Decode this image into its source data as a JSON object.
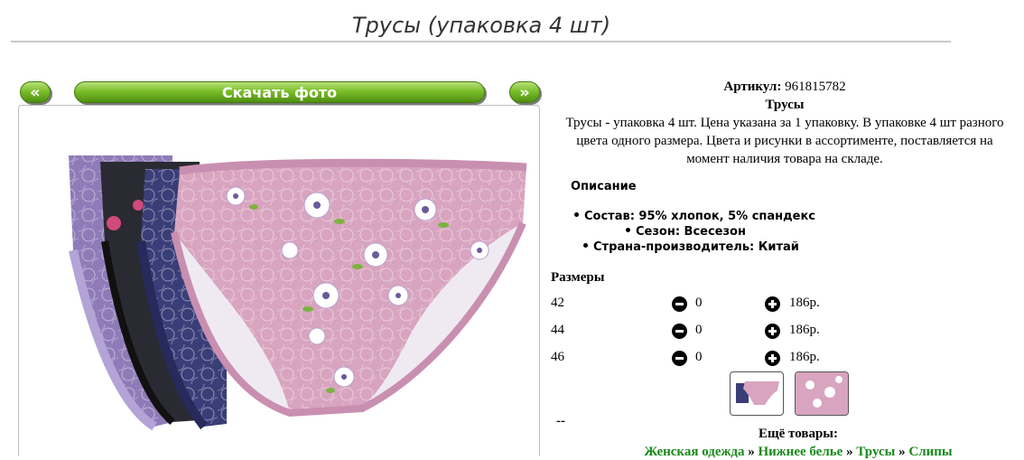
{
  "page": {
    "title": "Трусы (упаковка 4 шт)"
  },
  "gallery": {
    "prev_label": "«",
    "download_label": "Скачать фото",
    "next_label": "»"
  },
  "product": {
    "sku_label": "Артикул:",
    "sku_value": "961815782",
    "name": "Трусы",
    "description_lines": [
      "Трусы - упаковка 4 шт. Цена указана за 1 упаковку. В упаковке 4 шт разного",
      "цвета одного размера. Цвета и рисунки в ассортименте, поставляется на",
      "момент наличия товара на складе."
    ]
  },
  "description": {
    "heading": "Описание",
    "attributes": [
      "Состав: 95% хлопок, 5% спандекс",
      "Сезон: Всесезон",
      "Страна-производитель: Китай"
    ]
  },
  "sizes": {
    "heading": "Размеры",
    "rows": [
      {
        "size": "42",
        "qty": "0",
        "price": "186р."
      },
      {
        "size": "44",
        "qty": "0",
        "price": "186р."
      },
      {
        "size": "46",
        "qty": "0",
        "price": "186р."
      }
    ]
  },
  "more": {
    "dash": "--",
    "heading": "Ещё товары:",
    "breadcrumbs": [
      "Женская одежда",
      "Нижнее белье",
      "Трусы",
      "Слипы"
    ],
    "separator": "»"
  },
  "colors": {
    "accent_green": "#5a9e18",
    "link_green": "#1a8a1a",
    "panty_pink": "#d8a4bf",
    "panty_purple": "#8f7bb8",
    "panty_navy": "#3a3e78"
  }
}
